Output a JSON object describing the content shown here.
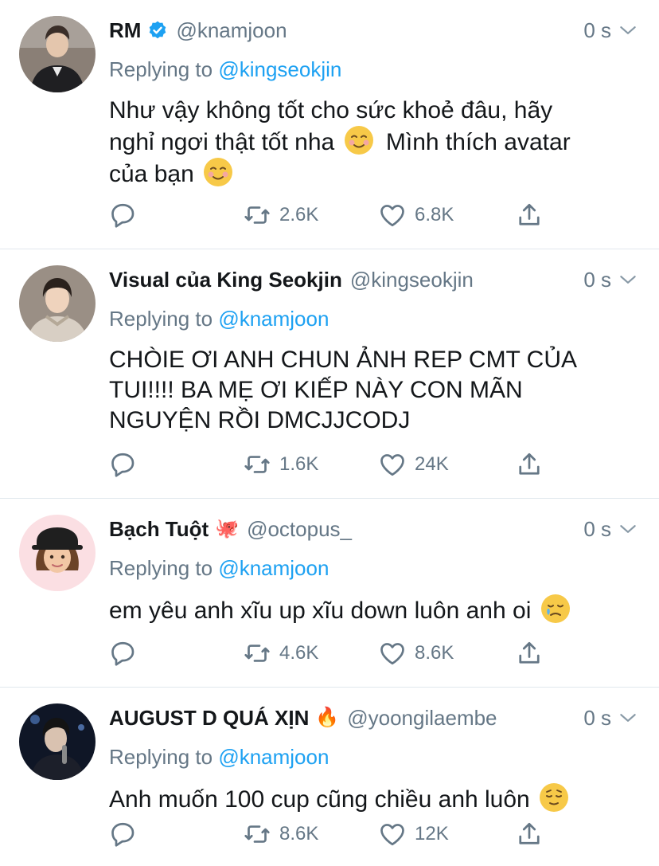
{
  "replying_label": "Replying to",
  "tweets": [
    {
      "name": "RM",
      "handle": "@knamjoon",
      "time": "0 s",
      "reply_to": "@kingseokjin",
      "text": [
        "Như vậy không tốt cho sức khoẻ đâu, hãy",
        "nghỉ ngơi thật tốt nha",
        "Mình thích avatar",
        "của bạn"
      ],
      "retweets": "2.6K",
      "likes": "6.8K"
    },
    {
      "name": "Visual của King Seokjin",
      "handle": "@kingseokjin",
      "time": "0 s",
      "reply_to": "@knamjoon",
      "text": [
        "CHÒIE ƠI ANH CHUN ẢNH REP CMT CỦA",
        "TUI!!!! BA MẸ ƠI KIẾP NÀY CON MÃN",
        "NGUYỆN RỒI DMCJJCODJ"
      ],
      "retweets": "1.6K",
      "likes": "24K"
    },
    {
      "name": "Bạch Tuột",
      "name_emoji": "🐙",
      "handle": "@octopus_",
      "time": "0 s",
      "reply_to": "@knamjoon",
      "text": [
        "em yêu anh xĩu up xĩu down luôn anh oi"
      ],
      "retweets": "4.6K",
      "likes": "8.6K"
    },
    {
      "name": "AUGUST D QUÁ XỊN",
      "name_emoji": "🔥",
      "handle": "@yoongilaembe",
      "time": "0 s",
      "reply_to": "@knamjoon",
      "text": [
        "Anh muốn 100 cup cũng chiều anh luôn"
      ],
      "retweets": "8.6K",
      "likes": "12K"
    }
  ],
  "colors": {
    "accent": "#1da1f2",
    "secondary": "#657786",
    "text": "#14171a",
    "divider": "#e1e8ed"
  },
  "icons": [
    "verified-badge-icon",
    "chevron-down-icon",
    "reply-icon",
    "retweet-icon",
    "like-icon",
    "share-icon",
    "smiling-face-icon",
    "crying-face-icon",
    "relieved-face-icon"
  ]
}
